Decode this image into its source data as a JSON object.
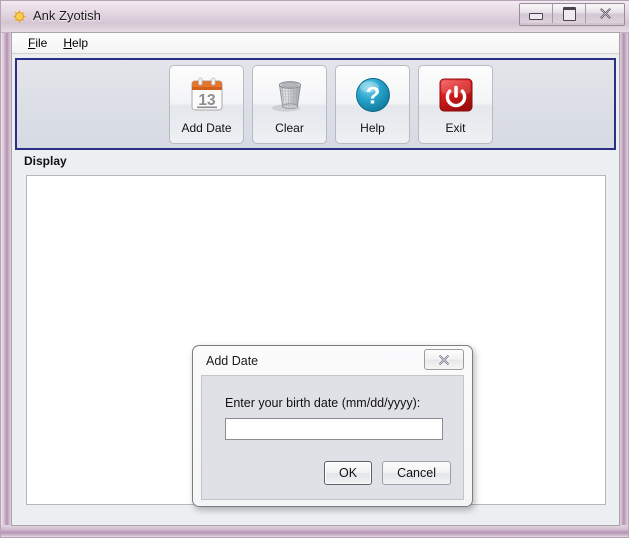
{
  "window": {
    "title": "Ank Zyotish",
    "icon": "sun-icon",
    "controls": {
      "minimize": "minimize-icon",
      "maximize": "maximize-icon",
      "close": "close-icon"
    }
  },
  "menu": {
    "items": [
      {
        "label": "File",
        "mnemonic": "F",
        "rest": "ile"
      },
      {
        "label": "Help",
        "mnemonic": "H",
        "rest": "elp"
      }
    ]
  },
  "toolbar": {
    "buttons": [
      {
        "label": "Add Date",
        "icon": "calendar-icon",
        "day": "13"
      },
      {
        "label": "Clear",
        "icon": "trash-bin-icon"
      },
      {
        "label": "Help",
        "icon": "question-mark-icon"
      },
      {
        "label": "Exit",
        "icon": "power-button-icon"
      }
    ]
  },
  "display": {
    "group_label": "Display",
    "content": ""
  },
  "dialog": {
    "title": "Add Date",
    "close_glyph": "✖",
    "prompt": "Enter your birth date (mm/dd/yyyy):",
    "input_value": "",
    "input_placeholder": "",
    "buttons": [
      {
        "label": "OK",
        "focused": true
      },
      {
        "label": "Cancel",
        "focused": false
      }
    ]
  },
  "colors": {
    "frame_glass": "#c9aec6",
    "toolbar_border": "#2b2f86",
    "exit_red": "#d81f1f",
    "help_blue": "#1b9ec6",
    "calendar_orange": "#d2601a"
  }
}
